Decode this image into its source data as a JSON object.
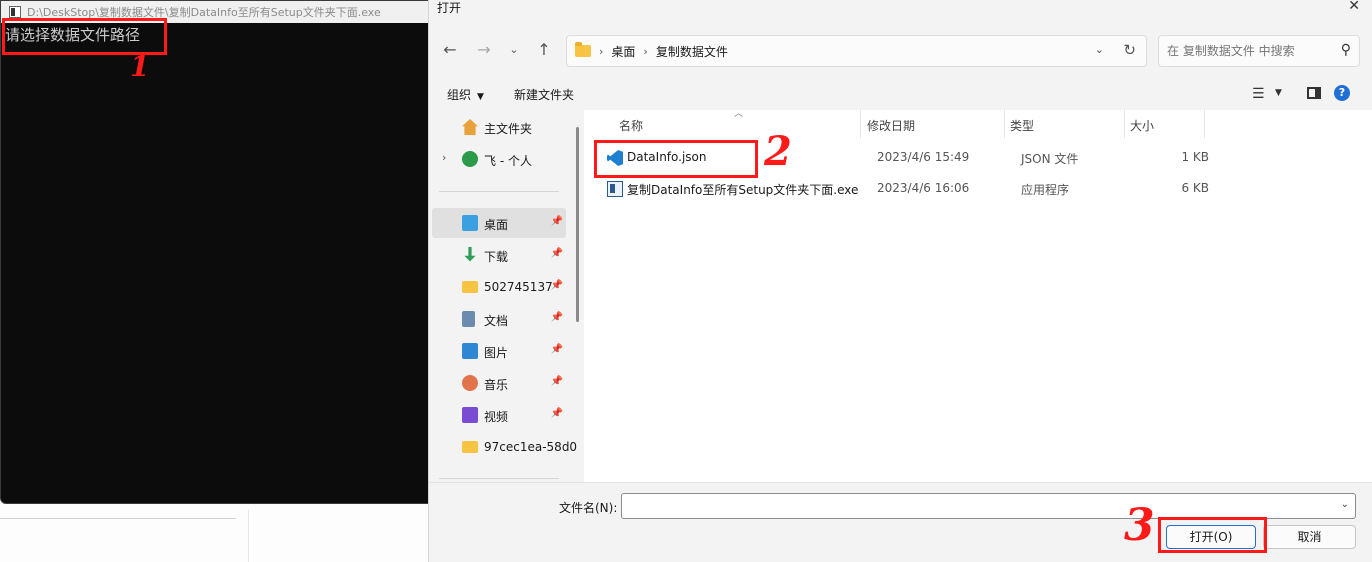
{
  "console": {
    "title": "D:\\DeskStop\\复制数据文件\\复制DataInfo至所有Setup文件夹下面.exe",
    "prompt": "请选择数据文件路径"
  },
  "annotations": [
    "1",
    "2",
    "3"
  ],
  "dialog": {
    "title": "打开",
    "close": "✕",
    "breadcrumb": [
      "桌面",
      "复制数据文件"
    ],
    "search_placeholder": "在 复制数据文件 中搜索",
    "toolbar": {
      "organize": "组织",
      "new_folder": "新建文件夹"
    },
    "nav_pane": [
      {
        "label": "主文件夹",
        "icon": "home-icon"
      },
      {
        "label": "飞 - 个人",
        "icon": "onedrive-icon"
      },
      {
        "label": "桌面",
        "icon": "desktop-icon",
        "pinned": true,
        "selected": true
      },
      {
        "label": "下载",
        "icon": "download-icon",
        "pinned": true
      },
      {
        "label": "502745137",
        "icon": "folder-icon",
        "pinned": true
      },
      {
        "label": "文档",
        "icon": "document-icon",
        "pinned": true
      },
      {
        "label": "图片",
        "icon": "pictures-icon",
        "pinned": true
      },
      {
        "label": "音乐",
        "icon": "music-icon",
        "pinned": true
      },
      {
        "label": "视频",
        "icon": "video-icon",
        "pinned": true
      },
      {
        "label": "97cec1ea-58d0",
        "icon": "folder-icon"
      }
    ],
    "columns": {
      "name": "名称",
      "date": "修改日期",
      "type": "类型",
      "size": "大小"
    },
    "files": [
      {
        "name": "DataInfo.json",
        "date": "2023/4/6 15:49",
        "type": "JSON 文件",
        "size": "1 KB",
        "icon": "vscode-file-icon"
      },
      {
        "name": "复制DataInfo至所有Setup文件夹下面.exe",
        "date": "2023/4/6 16:06",
        "type": "应用程序",
        "size": "6 KB",
        "icon": "exe-file-icon"
      }
    ],
    "filename_label": "文件名(N):",
    "filename_value": "",
    "open_button": "打开(O)",
    "cancel_button": "取消"
  },
  "colors": {
    "annotation": "#ff1a1a",
    "accent": "#1f6fd6",
    "console_bg": "#0c0c0c"
  }
}
